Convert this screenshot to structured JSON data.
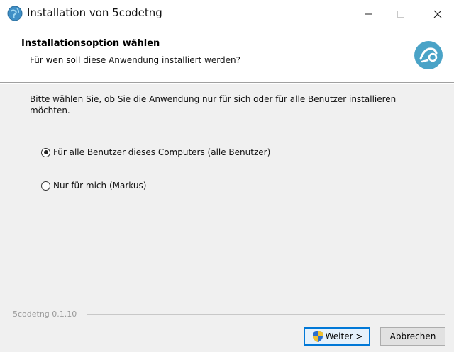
{
  "titlebar": {
    "title": "Installation von 5codetng",
    "icon": "installer-globe-icon",
    "minimize": "—",
    "maximize": "☐",
    "close": "✕"
  },
  "header": {
    "title": "Installationsoption wählen",
    "subtitle": "Für wen soll diese Anwendung installiert werden?",
    "logo": "app-logo-icon"
  },
  "body": {
    "intro": "Bitte wählen Sie, ob Sie die Anwendung nur für sich oder für alle Benutzer installieren möchten.",
    "options": [
      {
        "label": "Für alle Benutzer dieses Computers (alle Benutzer)",
        "selected": true
      },
      {
        "label": "Nur für mich (Markus)",
        "selected": false
      }
    ]
  },
  "footer": {
    "version": "5codetng 0.1.10"
  },
  "buttons": {
    "next": "Weiter >",
    "cancel": "Abbrechen"
  },
  "colors": {
    "accent": "#0078d7",
    "logo": "#4aa3c7"
  }
}
